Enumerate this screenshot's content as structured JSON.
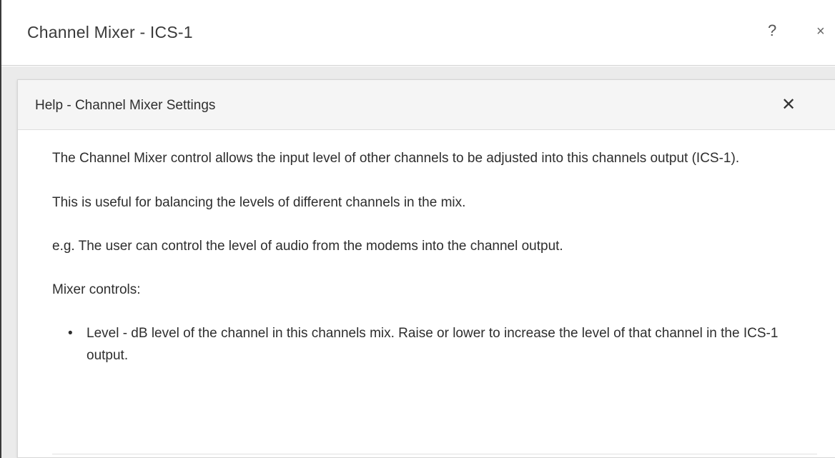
{
  "window": {
    "title": "Channel Mixer - ICS-1",
    "help_glyph": "?",
    "close_glyph": "×"
  },
  "help_panel": {
    "title": "Help - Channel Mixer Settings",
    "close_glyph": "✕",
    "paragraphs": [
      "The Channel Mixer control allows the input level of other channels to be adjusted into this channels output (ICS-1).",
      "This is useful for balancing the levels of different channels in the mix.",
      "e.g. The user can control the level of audio from the modems into the channel output.",
      "Mixer controls:"
    ],
    "list_items": [
      "Level - dB level of the channel in this channels mix. Raise or lower to increase the level of that channel in the ICS-1 output."
    ],
    "bullet_glyph": "•"
  },
  "colors": {
    "panel_header_bg": "#f5f5f5",
    "backdrop": "#ebebeb",
    "text": "#2e2e2e"
  }
}
